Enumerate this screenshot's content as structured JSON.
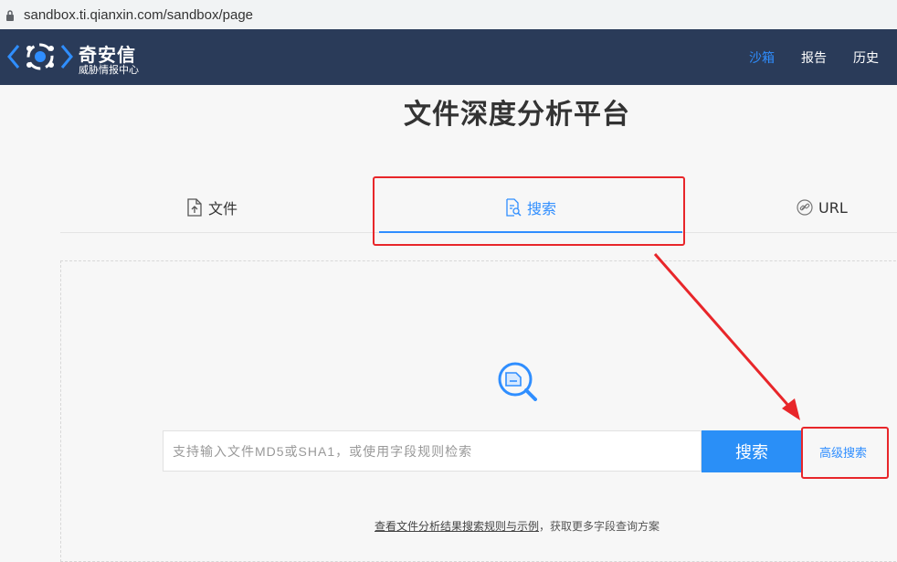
{
  "browser": {
    "url": "sandbox.ti.qianxin.com/sandbox/page"
  },
  "header": {
    "brand_name": "奇安信",
    "brand_sub": "威胁情报中心",
    "nav": [
      {
        "label": "沙箱",
        "active": true
      },
      {
        "label": "报告",
        "active": false
      },
      {
        "label": "历史",
        "active": false
      }
    ]
  },
  "page": {
    "title": "文件深度分析平台"
  },
  "tabs": {
    "file": "文件",
    "search": "搜索",
    "url": "URL"
  },
  "search": {
    "placeholder": "支持输入文件MD5或SHA1，或使用字段规则检索",
    "button": "搜索",
    "advanced": "高级搜索"
  },
  "footer": {
    "link": "查看文件分析结果搜索规则与示例",
    "rest": "，获取更多字段查询方案"
  },
  "colors": {
    "header_bg": "#2a3b59",
    "accent": "#2f8eff",
    "annotation": "#e8262a"
  }
}
